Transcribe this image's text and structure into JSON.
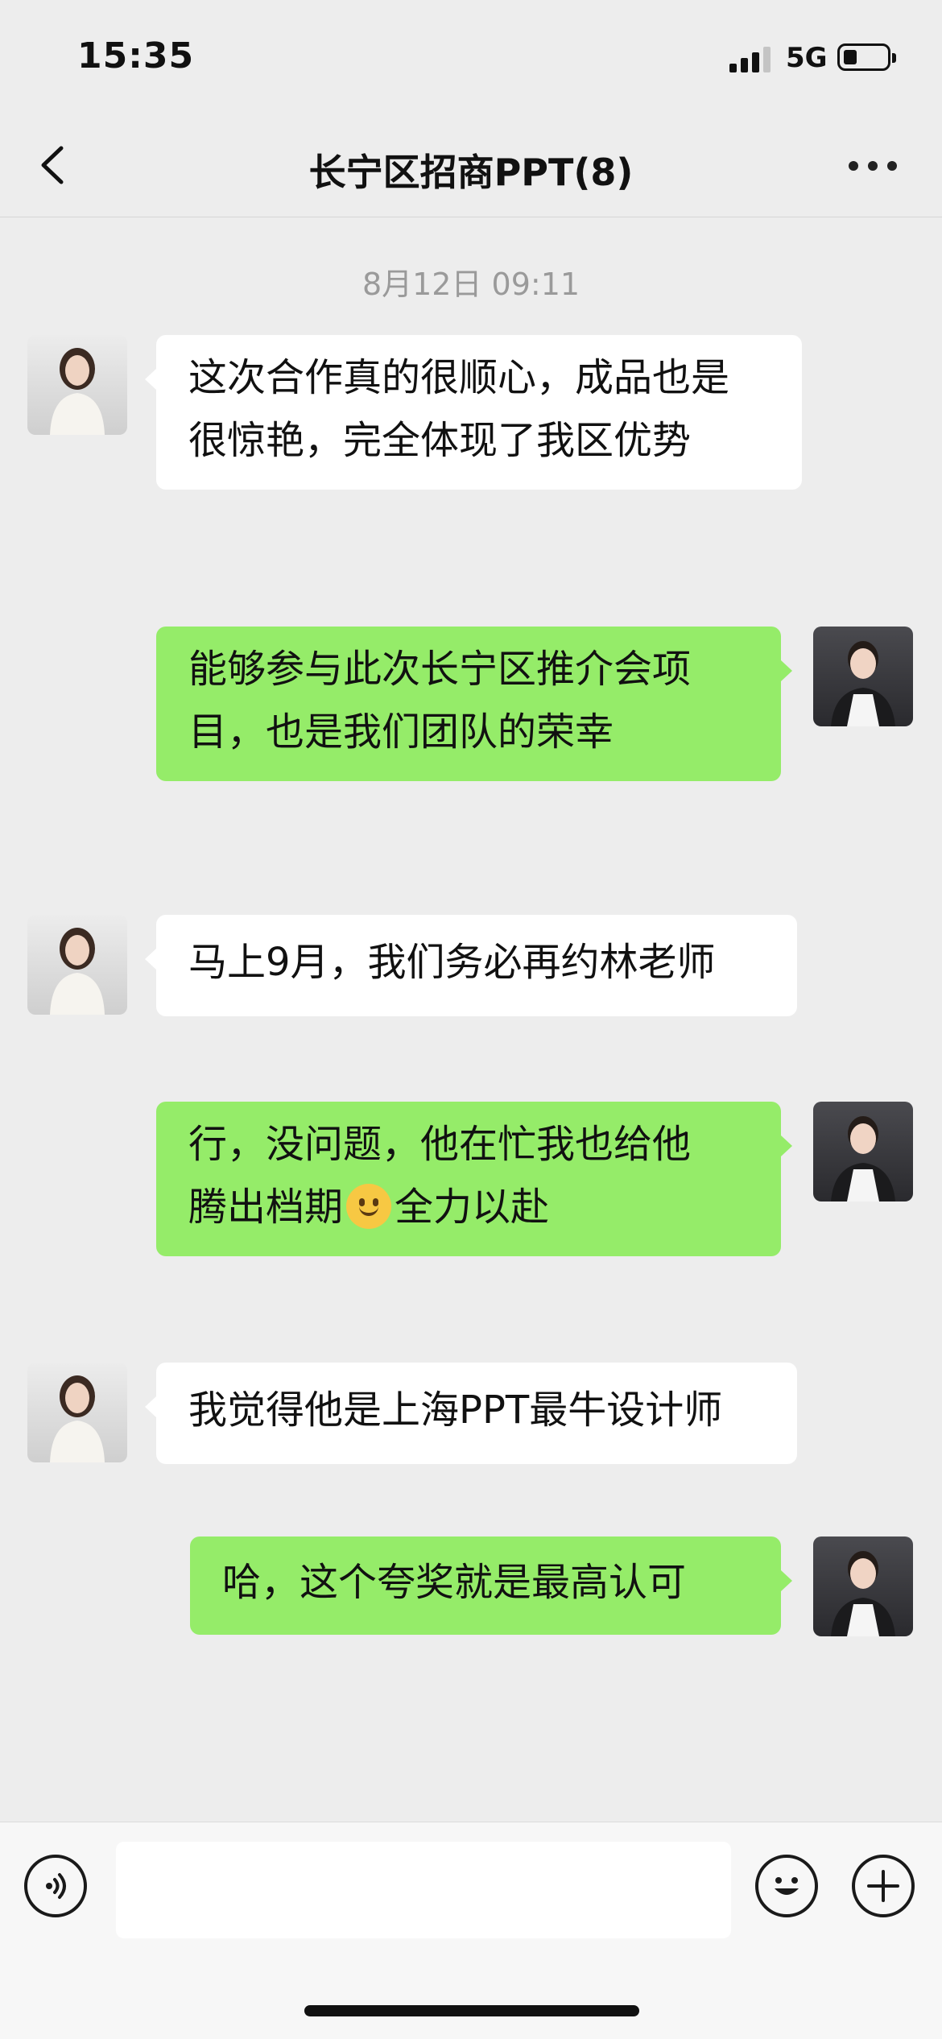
{
  "status": {
    "time": "15:35",
    "network": "5G",
    "battery_level": 0.3
  },
  "header": {
    "title": "长宁区招商PPT(8)"
  },
  "chat": {
    "timestamp": "8月12日 09:11",
    "messages": [
      {
        "side": "in",
        "lines": [
          "这次合作真的很顺心，成品也是",
          "很惊艳，完全体现了我区优势"
        ]
      },
      {
        "side": "out",
        "lines": [
          "能够参与此次长宁区推介会项",
          "目，也是我们团队的荣幸"
        ]
      },
      {
        "side": "in",
        "lines": [
          "马上9月，我们务必再约林老师"
        ]
      },
      {
        "side": "out",
        "lines": [
          "行，没问题，他在忙我也给他"
        ],
        "line2_before": "腾出档期",
        "emoji": "slightly-smiling-face",
        "line2_after": "全力以赴"
      },
      {
        "side": "in",
        "lines": [
          "我觉得他是上海PPT最牛设计师"
        ]
      },
      {
        "side": "out",
        "lines": [
          "哈，这个夸奖就是最高认可"
        ]
      }
    ]
  },
  "input": {
    "value": ""
  },
  "colors": {
    "background": "#ededed",
    "incoming_bubble": "#ffffff",
    "outgoing_bubble": "#95ec69",
    "timestamp": "#9a9a9a"
  }
}
